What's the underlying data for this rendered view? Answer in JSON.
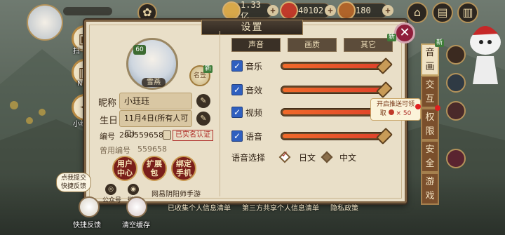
{
  "resources": [
    {
      "icon": "jade-icon",
      "value": "1.33亿",
      "color": "#d8a84a"
    },
    {
      "icon": "ruby-icon",
      "value": "40102",
      "color": "#c03a2a"
    },
    {
      "icon": "ration-icon",
      "value": "180",
      "color": "#b0642a"
    }
  ],
  "side_menu": {
    "scan": "扫一扫",
    "nfc": "NFC",
    "widget": "小组件"
  },
  "settings": {
    "title": "设置",
    "close": "✕",
    "profile": {
      "level": "60",
      "avatar_name": "雪燕",
      "badge_label": "名签",
      "badge_new": "新",
      "nickname_label": "昵称",
      "nickname_value": "小珏珏",
      "birthday_label": "生日",
      "birthday_value": "11月4日(所有人可见)",
      "id_label": "编号",
      "id_value": "200559658",
      "verified": "已实名认证",
      "used_id_label": "曾用编号",
      "used_id_value": "559658",
      "actions": [
        "用户\n中心",
        "扩展\n包",
        "绑定\n手机"
      ],
      "social_wechat": "公众号",
      "social_weibo": "微博",
      "game_name": "网易阴阳师手游"
    },
    "tabs": [
      {
        "label": "声音",
        "active": true
      },
      {
        "label": "画质",
        "active": false
      },
      {
        "label": "其它",
        "active": false,
        "new": "新"
      }
    ],
    "sliders": [
      {
        "label": "音乐",
        "checked": true,
        "level": 1.0
      },
      {
        "label": "音效",
        "checked": true,
        "level": 1.0
      },
      {
        "label": "视频",
        "checked": true,
        "level": 1.0
      },
      {
        "label": "语音",
        "checked": true,
        "level": 1.0
      }
    ],
    "voice_select": {
      "label": "语音选择",
      "options": [
        {
          "label": "日文",
          "selected": true
        },
        {
          "label": "中文",
          "selected": false
        }
      ]
    },
    "tip": {
      "line1": "开启推送可领",
      "line2": "取",
      "reward": "× 50"
    },
    "side_tabs": [
      {
        "label": "音画",
        "active": true,
        "new": "新"
      },
      {
        "label": "交互",
        "active": false
      },
      {
        "label": "权限",
        "active": false
      },
      {
        "label": "安全",
        "active": false
      },
      {
        "label": "游戏",
        "active": false
      }
    ]
  },
  "footer": {
    "links": [
      "已收集个人信息清单",
      "第三方共享个人信息清单",
      "隐私政策"
    ],
    "feedback_bubble": "点我提交\n快捷反馈",
    "feedback": "快捷反馈",
    "clear_cache": "清空缓存"
  },
  "colors": {
    "panel_bg": "#e9dfc8",
    "accent_red": "#e0422a",
    "checkbox_blue": "#2f5fbf"
  }
}
